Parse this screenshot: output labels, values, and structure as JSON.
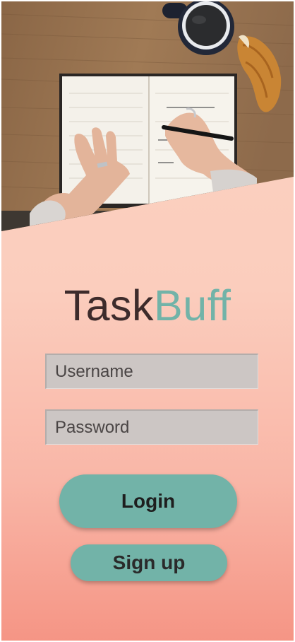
{
  "app": {
    "name_part1": "Task",
    "name_part2": "Buff"
  },
  "form": {
    "username_placeholder": "Username",
    "username_value": "",
    "password_placeholder": "Password",
    "password_value": ""
  },
  "actions": {
    "login_label": "Login",
    "signup_label": "Sign up"
  },
  "colors": {
    "accent": "#72b3a8",
    "logo_dark": "#3d2b2b",
    "field_bg": "#ccc6c4",
    "gradient_top": "#fbd3c2",
    "gradient_bottom": "#f59585"
  }
}
